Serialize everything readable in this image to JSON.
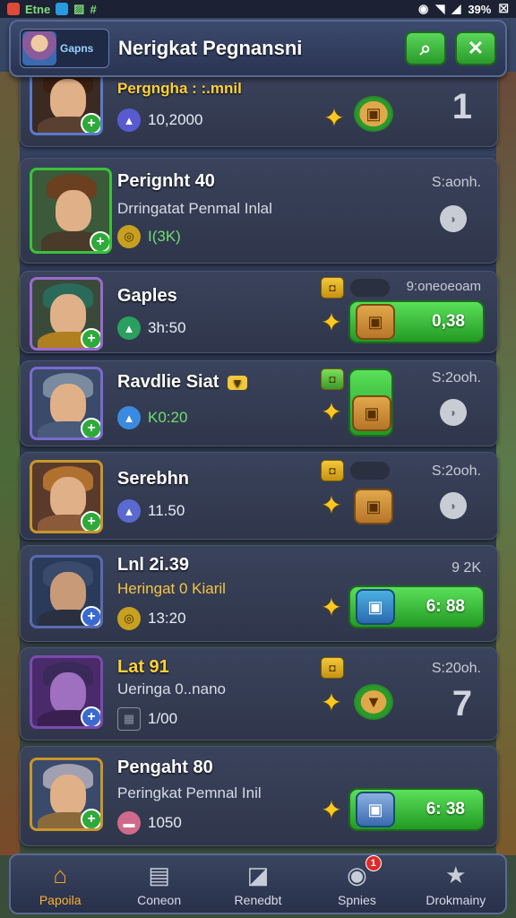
{
  "statusbar": {
    "left_text": "Etne",
    "right_text": "39%"
  },
  "header": {
    "app_name": "Gapns",
    "title": "Nerigkat Pegnansni"
  },
  "rows": [
    {
      "name": "Pergngha : :.mnil",
      "stat": "10,2000",
      "rank_big": "1"
    },
    {
      "name": "Perignht 40",
      "sub": "Drringatat Penmal Inlal",
      "stat": "I(3K)",
      "rank": "S:aonh."
    },
    {
      "name": "Gaples",
      "stat": "3h:50",
      "rank_top": "9:oneoeoam",
      "value": "0,38"
    },
    {
      "name": "Ravdlie Siat",
      "stat": "K0:20",
      "rank": "S:2ooh."
    },
    {
      "name": "Serebhn",
      "stat": "11.50",
      "rank": "S:2ooh."
    },
    {
      "name": "Lnl 2i.39",
      "sub": "Heringat 0 Kiaril",
      "stat": "13:20",
      "rank": "9 2K",
      "value": "6: 88"
    },
    {
      "name": "Lat 91",
      "sub": "Ueringa 0..nano",
      "stat": "1/00",
      "rank": "S:20oh.",
      "rank_big": "7"
    },
    {
      "name": "Pengaht 80",
      "sub": "Peringkat Pemnal Inil",
      "stat": "1050",
      "value": "6: 38"
    }
  ],
  "tabs": [
    {
      "label": "Papoila",
      "icon": "house-icon"
    },
    {
      "label": "Coneon",
      "icon": "scroll-icon"
    },
    {
      "label": "Renedbt",
      "icon": "card-icon"
    },
    {
      "label": "Spnies",
      "icon": "pin-icon",
      "badge": "1"
    },
    {
      "label": "Drokmainy",
      "icon": "star-icon"
    }
  ]
}
